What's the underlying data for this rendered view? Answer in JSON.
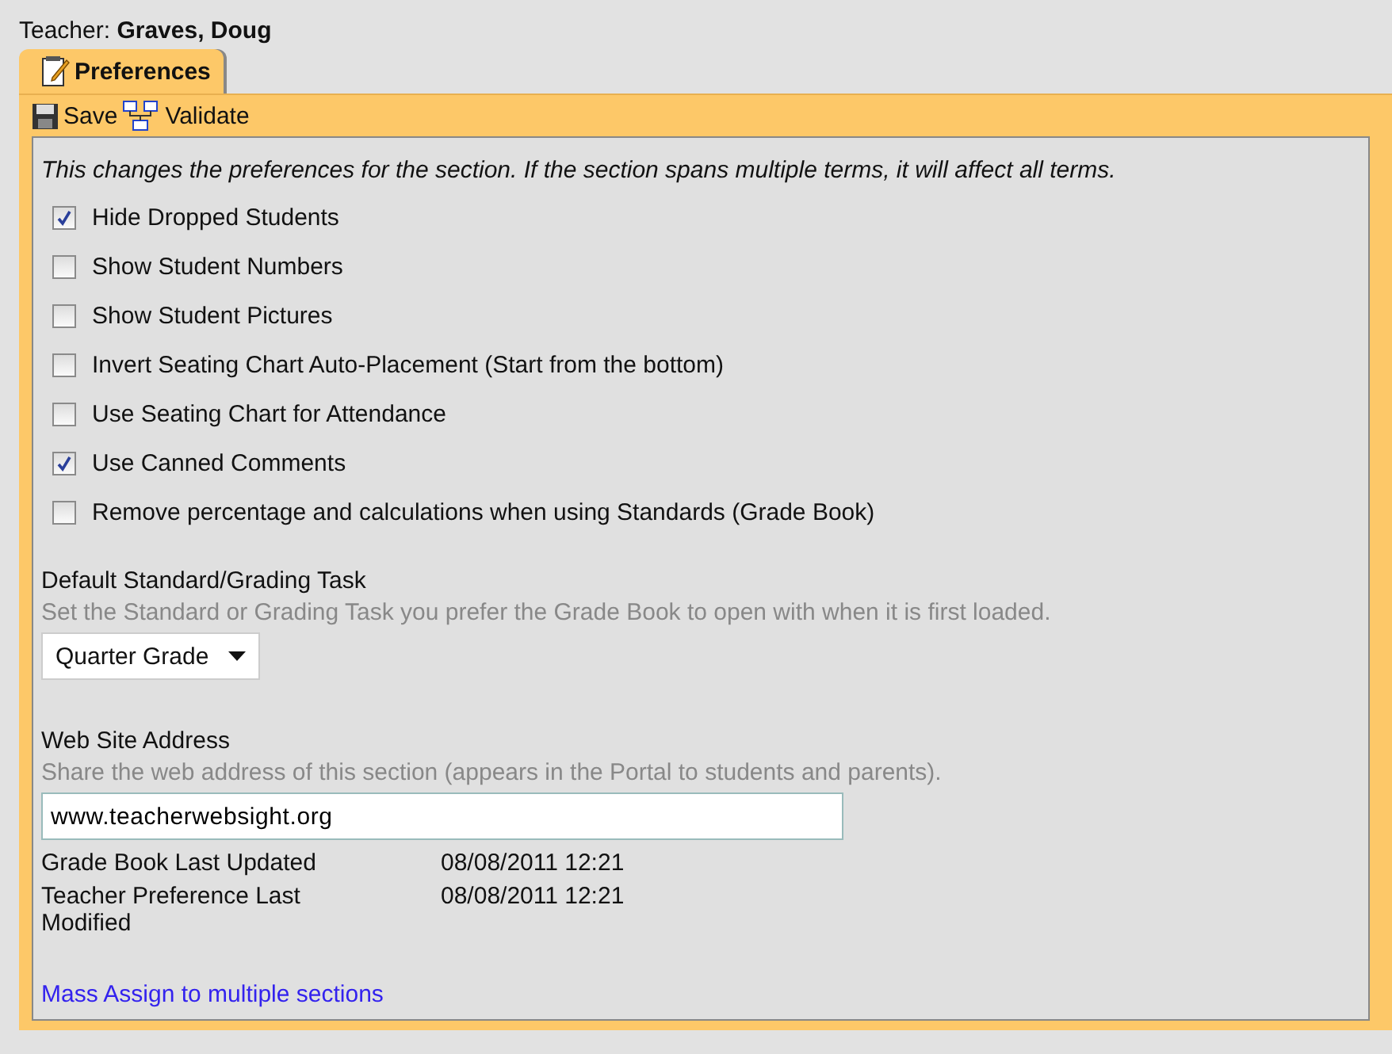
{
  "header": {
    "teacher": "Teacher: **Graves, Doug**"
  },
  "tabs": [
    {
      "label": "Preferences",
      "selected": true
    }
  ],
  "toolbar": [
    {
      "kind": "save",
      "label": "Save"
    },
    {
      "kind": "validate",
      "label": "Validate"
    }
  ],
  "intro": "This changes the preferences for the section. If the section spans multiple terms, it will affect all terms.",
  "options": [
    {
      "label": "Hide Dropped Students",
      "checked": true
    },
    {
      "label": "Show Student Numbers",
      "checked": false
    },
    {
      "label": "Show Student Pictures",
      "checked": false
    },
    {
      "label": "Invert Seating Chart Auto-Placement (Start from the bottom)",
      "checked": false
    },
    {
      "label": "Use Seating Chart for Attendance",
      "checked": false
    },
    {
      "label": "Use Canned Comments",
      "checked": true
    },
    {
      "label": "Remove percentage and calculations when using Standards (Grade Book)",
      "checked": false
    }
  ],
  "default_task": {
    "label": "Default Standard/Grading Task",
    "hint": "Set the Standard or Grading Task you prefer the Grade Book to open with when it is first loaded.",
    "value": "Quarter Grade"
  },
  "website": {
    "label": "Web Site Address",
    "hint": "Share the web address of this section (appears in the Portal to students and parents).",
    "value": "www.teacherwebsight.org"
  },
  "info": [
    {
      "label": "Grade Book Last Updated",
      "value": "08/08/2011 12:21"
    },
    {
      "label": "Teacher Preference Last Modified",
      "value": "08/08/2011 12:21"
    }
  ],
  "link": "Mass Assign to multiple sections"
}
